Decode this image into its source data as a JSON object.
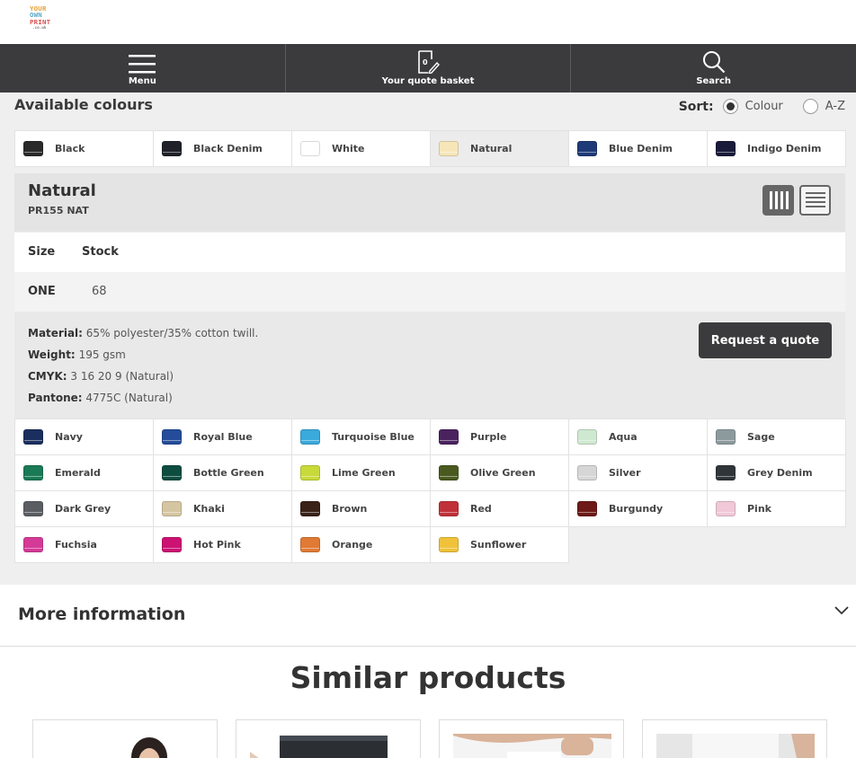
{
  "logo": {
    "lines": [
      "YOUR",
      "OWN",
      "PRINT"
    ],
    "domain": ".co.uk",
    "colors": [
      "#e8a13a",
      "#5aa9c8",
      "#d9534f"
    ]
  },
  "nav": {
    "menu": "Menu",
    "basket": "Your quote basket",
    "basket_count": "0",
    "search": "Search"
  },
  "available": {
    "title": "Available colours",
    "sort_label": "Sort:",
    "sort_options": [
      "Colour",
      "A-Z"
    ],
    "sort_selected": "Colour"
  },
  "top_swatches": [
    {
      "name": "Black",
      "color": "#2a2a2a"
    },
    {
      "name": "Black Denim",
      "color": "#1e2228"
    },
    {
      "name": "White",
      "color": "#ffffff"
    },
    {
      "name": "Natural",
      "color": "#f6e6b8"
    },
    {
      "name": "Blue Denim",
      "color": "#1f3a78"
    },
    {
      "name": "Indigo Denim",
      "color": "#1a1a3a"
    }
  ],
  "selected": {
    "name": "Natural",
    "code": "PR155 NAT",
    "stock_headers": [
      "Size",
      "Stock"
    ],
    "size": "ONE",
    "stock": "68",
    "specs": [
      {
        "label": "Material:",
        "value": "65% polyester/35% cotton twill."
      },
      {
        "label": "Weight:",
        "value": "195 gsm"
      },
      {
        "label": "CMYK:",
        "value": "3 16 20 9 (Natural)"
      },
      {
        "label": "Pantone:",
        "value": "4775C (Natural)"
      }
    ],
    "quote_button": "Request a quote"
  },
  "more_swatches": [
    {
      "name": "Navy",
      "color": "#1b2f5e"
    },
    {
      "name": "Royal Blue",
      "color": "#244c9a"
    },
    {
      "name": "Turquoise Blue",
      "color": "#3aa9dc"
    },
    {
      "name": "Purple",
      "color": "#4a235e"
    },
    {
      "name": "Aqua",
      "color": "#cfe8d0"
    },
    {
      "name": "Sage",
      "color": "#8c9a9e"
    },
    {
      "name": "Emerald",
      "color": "#1a7a56"
    },
    {
      "name": "Bottle Green",
      "color": "#0d4d40"
    },
    {
      "name": "Lime Green",
      "color": "#c8d93a"
    },
    {
      "name": "Olive Green",
      "color": "#4a5a1f"
    },
    {
      "name": "Silver",
      "color": "#d6d6d6"
    },
    {
      "name": "Grey Denim",
      "color": "#2f3538"
    },
    {
      "name": "Dark Grey",
      "color": "#5a5e63"
    },
    {
      "name": "Khaki",
      "color": "#d5c6a2"
    },
    {
      "name": "Brown",
      "color": "#3a2219"
    },
    {
      "name": "Red",
      "color": "#c0313a"
    },
    {
      "name": "Burgundy",
      "color": "#6e1a18"
    },
    {
      "name": "Pink",
      "color": "#f1c8d8"
    },
    {
      "name": "Fuchsia",
      "color": "#d43a96"
    },
    {
      "name": "Hot Pink",
      "color": "#cc1272"
    },
    {
      "name": "Orange",
      "color": "#e07a35"
    },
    {
      "name": "Sunflower",
      "color": "#f0c23a"
    }
  ],
  "more_info": {
    "title": "More information"
  },
  "similar": {
    "title": "Similar products"
  }
}
